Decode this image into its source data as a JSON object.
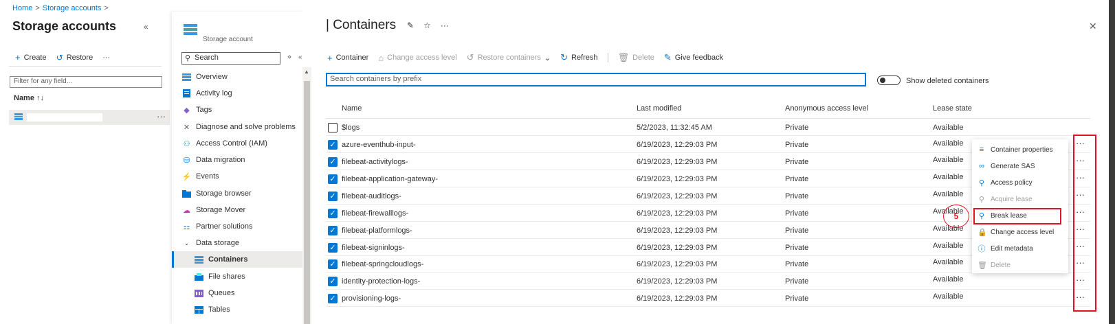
{
  "breadcrumb": {
    "home": "Home",
    "sep1": ">",
    "storage_accounts": "Storage accounts",
    "sep2": ">"
  },
  "left_pane": {
    "title": "Storage accounts",
    "collapse_icon": "«",
    "actions": {
      "create": "Create",
      "restore": "Restore",
      "more": "···"
    },
    "filter_placeholder": "Filter for any field...",
    "name_header": "Name ↑↓",
    "row_more": "···"
  },
  "resource_menu": {
    "subtitle": "Storage account",
    "search_placeholder": "Search",
    "search_opts": "⋄",
    "collapse": "«",
    "items": [
      {
        "label": "Overview",
        "icon": "overview-icon"
      },
      {
        "label": "Activity log",
        "icon": "activity-log-icon"
      },
      {
        "label": "Tags",
        "icon": "tag-icon"
      },
      {
        "label": "Diagnose and solve problems",
        "icon": "wrench-icon"
      },
      {
        "label": "Access Control (IAM)",
        "icon": "people-icon"
      },
      {
        "label": "Data migration",
        "icon": "migration-icon"
      },
      {
        "label": "Events",
        "icon": "lightning-icon"
      },
      {
        "label": "Storage browser",
        "icon": "folder-icon"
      },
      {
        "label": "Storage Mover",
        "icon": "cloud-icon"
      },
      {
        "label": "Partner solutions",
        "icon": "partner-icon"
      },
      {
        "label": "Data storage",
        "icon": "chevron-down-icon"
      },
      {
        "label": "Containers",
        "icon": "containers-icon"
      },
      {
        "label": "File shares",
        "icon": "file-shares-icon"
      },
      {
        "label": "Queues",
        "icon": "queues-icon"
      },
      {
        "label": "Tables",
        "icon": "tables-icon"
      }
    ]
  },
  "main": {
    "title": "| Containers",
    "pin_icon": "✎",
    "star_icon": "☆",
    "more_icon": "···",
    "close": "✕",
    "toolbar": {
      "container": "Container",
      "change_access": "Change access level",
      "restore": "Restore containers",
      "refresh": "Refresh",
      "delete": "Delete",
      "feedback": "Give feedback"
    },
    "search_placeholder": "Search containers by prefix",
    "show_deleted_label": "Show deleted containers",
    "columns": [
      "Name",
      "Last modified",
      "Anonymous access level",
      "Lease state"
    ],
    "rows": [
      {
        "name": "$logs",
        "modified": "5/2/2023, 11:32:45 AM",
        "access": "Private",
        "lease": "Available",
        "checked": false
      },
      {
        "name": "azure-eventhub-input-",
        "modified": "6/19/2023, 12:29:03 PM",
        "access": "Private",
        "lease": "Available",
        "checked": true
      },
      {
        "name": "filebeat-activitylogs-",
        "modified": "6/19/2023, 12:29:03 PM",
        "access": "Private",
        "lease": "Available",
        "checked": true
      },
      {
        "name": "filebeat-application-gateway-",
        "modified": "6/19/2023, 12:29:03 PM",
        "access": "Private",
        "lease": "Available",
        "checked": true
      },
      {
        "name": "filebeat-auditlogs-",
        "modified": "6/19/2023, 12:29:03 PM",
        "access": "Private",
        "lease": "Available",
        "checked": true
      },
      {
        "name": "filebeat-firewalllogs-",
        "modified": "6/19/2023, 12:29:03 PM",
        "access": "Private",
        "lease": "Available",
        "checked": true
      },
      {
        "name": "filebeat-platformlogs-",
        "modified": "6/19/2023, 12:29:03 PM",
        "access": "Private",
        "lease": "Available",
        "checked": true
      },
      {
        "name": "filebeat-signinlogs-",
        "modified": "6/19/2023, 12:29:03 PM",
        "access": "Private",
        "lease": "Available",
        "checked": true
      },
      {
        "name": "filebeat-springcloudlogs-",
        "modified": "6/19/2023, 12:29:03 PM",
        "access": "Private",
        "lease": "Available",
        "checked": true
      },
      {
        "name": "identity-protection-logs-",
        "modified": "6/19/2023, 12:29:03 PM",
        "access": "Private",
        "lease": "Available",
        "checked": true
      },
      {
        "name": "provisioning-logs-",
        "modified": "6/19/2023, 12:29:03 PM",
        "access": "Private",
        "lease": "Available",
        "checked": true
      }
    ],
    "row_more": "···"
  },
  "context_menu": {
    "items": [
      {
        "label": "Container properties",
        "icon": "≡",
        "disabled": false
      },
      {
        "label": "Generate SAS",
        "icon": "∞",
        "disabled": false
      },
      {
        "label": "Access policy",
        "icon": "⚲",
        "disabled": false
      },
      {
        "label": "Acquire lease",
        "icon": "⚲",
        "disabled": true
      },
      {
        "label": "Break lease",
        "icon": "⚲",
        "disabled": false
      },
      {
        "label": "Change access level",
        "icon": "🔒",
        "disabled": false
      },
      {
        "label": "Edit metadata",
        "icon": "ⓘ",
        "disabled": false
      },
      {
        "label": "Delete",
        "icon": "🗑",
        "disabled": true
      }
    ]
  },
  "annotation": {
    "step": "5"
  },
  "colors": {
    "accent": "#0078d4",
    "highlight": "#e81123"
  }
}
